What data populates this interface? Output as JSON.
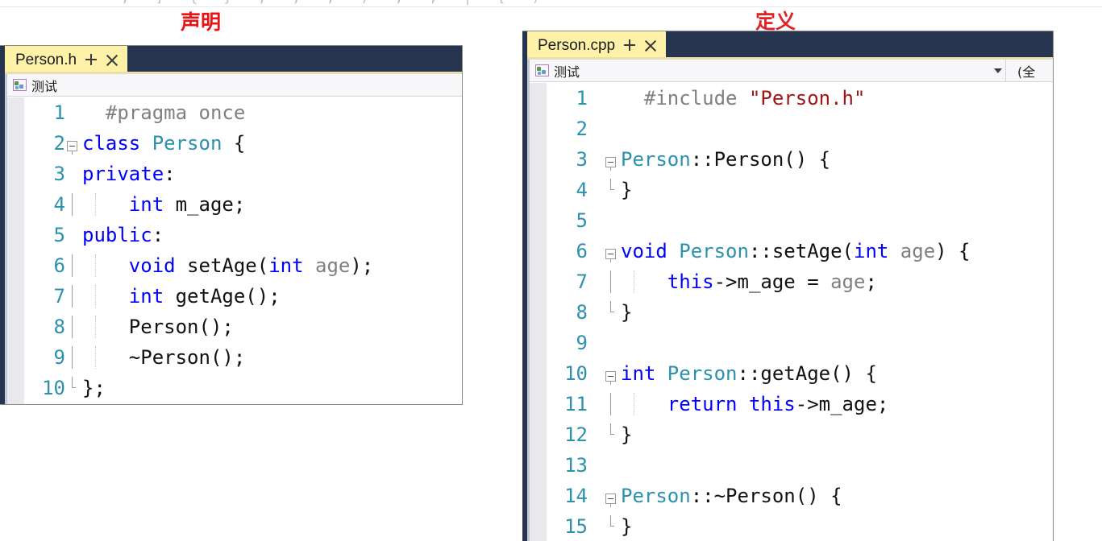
{
  "annotations": {
    "declaration_label": "声明",
    "definition_label": "定义",
    "accent_color": "#ee1111"
  },
  "top_clipped_text": "; ] { } , ; , ) ; , | [ )",
  "theme": {
    "tab_active_bg": "#fdf2a8",
    "tab_strip_bg": "#27344f",
    "keyword_color": "#0000ff",
    "type_color": "#2b91af",
    "string_color": "#a31515",
    "preprocessor_color": "#808080",
    "parameter_color": "#808080",
    "line_number_color": "#2b91af",
    "indicator_margin_color": "#e9e9ec"
  },
  "left_panel": {
    "tab": {
      "title": "Person.h",
      "pin_icon": "pin-icon",
      "close_icon": "close-icon"
    },
    "nav_bar": {
      "scope_icon": "project-scope-icon",
      "scope_label": "测试"
    },
    "lines": [
      {
        "n": "1",
        "tokens": [
          {
            "t": "  ",
            "c": "t-plain"
          },
          {
            "t": "#pragma once",
            "c": "t-pp"
          }
        ]
      },
      {
        "n": "2",
        "fold": "start",
        "tokens": [
          {
            "t": "class ",
            "c": "t-kw"
          },
          {
            "t": "Person",
            "c": "t-type"
          },
          {
            "t": " {",
            "c": "t-plain"
          }
        ]
      },
      {
        "n": "3",
        "tokens": [
          {
            "t": "private",
            "c": "t-kw"
          },
          {
            "t": ":",
            "c": "t-plain"
          }
        ]
      },
      {
        "n": "4",
        "indent": true,
        "tokens": [
          {
            "t": "    ",
            "c": "t-plain"
          },
          {
            "t": "int ",
            "c": "t-kw"
          },
          {
            "t": "m_age;",
            "c": "t-plain"
          }
        ]
      },
      {
        "n": "5",
        "tokens": [
          {
            "t": "public",
            "c": "t-kw"
          },
          {
            "t": ":",
            "c": "t-plain"
          }
        ]
      },
      {
        "n": "6",
        "indent": true,
        "tokens": [
          {
            "t": "    ",
            "c": "t-plain"
          },
          {
            "t": "void ",
            "c": "t-kw"
          },
          {
            "t": "setAge(",
            "c": "t-plain"
          },
          {
            "t": "int ",
            "c": "t-kw"
          },
          {
            "t": "age",
            "c": "t-param"
          },
          {
            "t": ");",
            "c": "t-plain"
          }
        ]
      },
      {
        "n": "7",
        "indent": true,
        "tokens": [
          {
            "t": "    ",
            "c": "t-plain"
          },
          {
            "t": "int ",
            "c": "t-kw"
          },
          {
            "t": "getAge();",
            "c": "t-plain"
          }
        ]
      },
      {
        "n": "8",
        "indent": true,
        "tokens": [
          {
            "t": "    Person();",
            "c": "t-plain"
          }
        ]
      },
      {
        "n": "9",
        "indent": true,
        "tokens": [
          {
            "t": "    ~Person();",
            "c": "t-plain"
          }
        ]
      },
      {
        "n": "10",
        "fold": "end",
        "tokens": [
          {
            "t": "};",
            "c": "t-plain"
          }
        ]
      }
    ]
  },
  "right_panel": {
    "tab": {
      "title": "Person.cpp",
      "pin_icon": "pin-icon",
      "close_icon": "close-icon"
    },
    "nav_bar": {
      "scope_icon": "project-scope-icon",
      "scope_label": "测试",
      "member_label": "(全"
    },
    "lines": [
      {
        "n": "1",
        "tokens": [
          {
            "t": "  ",
            "c": "t-plain"
          },
          {
            "t": "#include ",
            "c": "t-pp"
          },
          {
            "t": "\"Person.h\"",
            "c": "t-str"
          }
        ]
      },
      {
        "n": "2",
        "tokens": []
      },
      {
        "n": "3",
        "fold": "start",
        "tokens": [
          {
            "t": "Person",
            "c": "t-type"
          },
          {
            "t": "::Person() {",
            "c": "t-plain"
          }
        ]
      },
      {
        "n": "4",
        "fold": "end",
        "tokens": [
          {
            "t": "}",
            "c": "t-plain"
          }
        ]
      },
      {
        "n": "5",
        "tokens": []
      },
      {
        "n": "6",
        "fold": "start",
        "tokens": [
          {
            "t": "void ",
            "c": "t-kw"
          },
          {
            "t": "Person",
            "c": "t-type"
          },
          {
            "t": "::setAge(",
            "c": "t-plain"
          },
          {
            "t": "int ",
            "c": "t-kw"
          },
          {
            "t": "age",
            "c": "t-param"
          },
          {
            "t": ") {",
            "c": "t-plain"
          }
        ]
      },
      {
        "n": "7",
        "indent": true,
        "tokens": [
          {
            "t": "    ",
            "c": "t-plain"
          },
          {
            "t": "this",
            "c": "t-kw"
          },
          {
            "t": "->m_age = ",
            "c": "t-plain"
          },
          {
            "t": "age",
            "c": "t-param"
          },
          {
            "t": ";",
            "c": "t-plain"
          }
        ]
      },
      {
        "n": "8",
        "fold": "end",
        "tokens": [
          {
            "t": "}",
            "c": "t-plain"
          }
        ]
      },
      {
        "n": "9",
        "tokens": []
      },
      {
        "n": "10",
        "fold": "start",
        "tokens": [
          {
            "t": "int ",
            "c": "t-kw"
          },
          {
            "t": "Person",
            "c": "t-type"
          },
          {
            "t": "::getAge() {",
            "c": "t-plain"
          }
        ]
      },
      {
        "n": "11",
        "indent": true,
        "tokens": [
          {
            "t": "    ",
            "c": "t-plain"
          },
          {
            "t": "return ",
            "c": "t-kw"
          },
          {
            "t": "this",
            "c": "t-kw"
          },
          {
            "t": "->m_age;",
            "c": "t-plain"
          }
        ]
      },
      {
        "n": "12",
        "fold": "end",
        "tokens": [
          {
            "t": "}",
            "c": "t-plain"
          }
        ]
      },
      {
        "n": "13",
        "tokens": []
      },
      {
        "n": "14",
        "fold": "start",
        "tokens": [
          {
            "t": "Person",
            "c": "t-type"
          },
          {
            "t": "::~Person() {",
            "c": "t-plain"
          }
        ]
      },
      {
        "n": "15",
        "fold": "end",
        "tokens": [
          {
            "t": "}",
            "c": "t-plain"
          }
        ]
      }
    ]
  }
}
